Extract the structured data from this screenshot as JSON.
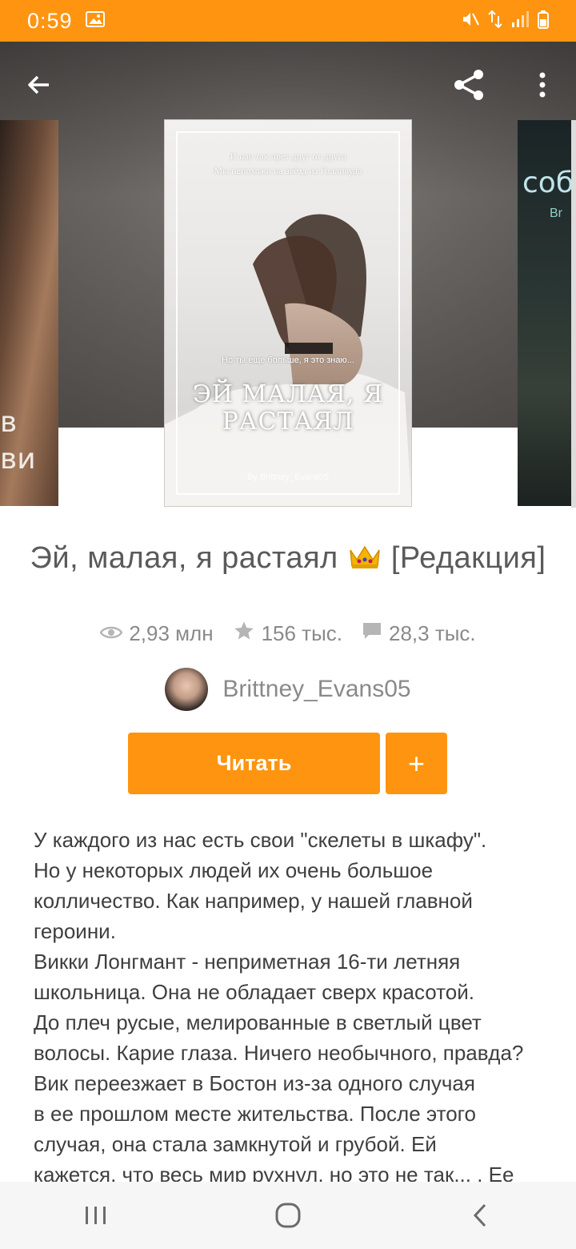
{
  "status_bar": {
    "time": "0:59",
    "icons": [
      "image-icon",
      "mute-icon",
      "data-arrows-icon",
      "signal-icon",
      "battery-icon"
    ],
    "color": "#ff9410"
  },
  "header": {
    "icons": [
      "back-arrow-icon",
      "share-icon",
      "more-vertical-icon"
    ]
  },
  "covers": {
    "left_partial_text": "в\nви",
    "main": {
      "top_text_1": "И нас так прет друг от друга",
      "top_text_2": "Мы непохожи на звёзд из Голливуда",
      "mid_text": "Но ты еще больше, я это знаю...",
      "title_line_1": "ЭЙ МАЛАЯ, Я",
      "title_line_2": "РАСТАЯЛ",
      "author_line": "By Brittney_Evans05"
    },
    "right_partial_text": "соб",
    "right_partial_sub": "Br"
  },
  "book": {
    "title_before": "Эй, малая, я растаял ",
    "title_after": " [Редакция]",
    "title_emoji": "crown-icon"
  },
  "stats": {
    "reads": "2,93 млн",
    "votes": "156 тыс.",
    "comments": "28,3 тыс."
  },
  "author": {
    "name": "Brittney_Evans05"
  },
  "actions": {
    "read_label": "Читать",
    "add_label": "+",
    "accent": "#ff9410"
  },
  "description": [
    "У каждого из нас есть свои \"скелеты в шкафу\".",
    "Но у некоторых людей их очень большое",
    "колличество. Как например, у нашей главной",
    "героини.",
    "Викки Лонгмант - неприметная 16-ти летняя",
    "школьница. Она не обладает сверх красотой.",
    "До плеч русые, мелированные в светлый цвет",
    "волосы. Карие глаза. Ничего необычного, правда?",
    "Вик переезжает в Бостон из-за одного случая",
    "в ее прошлом месте жительства. После этого",
    "случая, она стала замкнутой и грубой. Ей",
    "кажется, что весь мир рухнул, но это не так... . Ее"
  ],
  "nav": {
    "icons": [
      "recent-apps-icon",
      "home-icon",
      "back-nav-icon"
    ]
  }
}
